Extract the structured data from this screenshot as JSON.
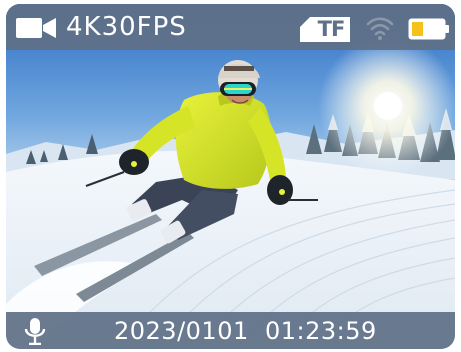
{
  "status_bar": {
    "mode_icon": "video-camera-icon",
    "mode_label": "4K30FPS",
    "storage_icon": "sd-card-icon",
    "storage_label": "TF",
    "wifi_icon": "wifi-icon",
    "battery_icon": "battery-icon",
    "battery_level": 0.35,
    "battery_color": "#f4c21a"
  },
  "bottom_bar": {
    "mic_icon": "microphone-icon",
    "date": "2023/0101",
    "time": "01:23:59"
  },
  "colors": {
    "bar_background": "#607086",
    "text": "#ffffff"
  }
}
